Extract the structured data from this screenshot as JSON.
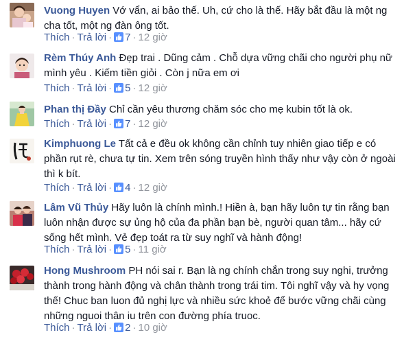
{
  "ui": {
    "like_label": "Thích",
    "reply_label": "Trả lời",
    "separator": "·"
  },
  "comments": [
    {
      "author": "Vuong Huyen",
      "text": "Vớ vẩn, ai bảo thế. Uh, cứ cho là thế. Hãy bắt đầu là một ng cha tốt, một ng đàn ông tốt.",
      "likes": "7",
      "time": "12 giờ",
      "avatar_icon": "woman-with-child-photo"
    },
    {
      "author": "Rèm Thúy Anh",
      "text": "Đẹp trai . Dũng cảm . Chỗ dựa vững chãi cho người phụ nữ mình yêu . Kiếm tiền giỏi . Còn j nữa em ơi",
      "likes": "5",
      "time": "12 giờ",
      "avatar_icon": "child-photo"
    },
    {
      "author": "Phan thị Đầy",
      "text": "Chỉ cần yêu thương chăm sóc cho mẹ kubin tốt là ok.",
      "likes": "7",
      "time": "12 giờ",
      "avatar_icon": "woman-in-yellow-dress-photo"
    },
    {
      "author": "Kimphuong Le",
      "text": "Tất cả e đều ok không cần chỉnh tuy nhiên giao tiếp e có phần rụt rè, chưa tự tin. Xem trên sóng truyền hình thấy như vậy còn ở ngoài thì k bít.",
      "likes": "4",
      "time": "12 giờ",
      "avatar_icon": "calligraphy-logo"
    },
    {
      "author": "Lâm Vũ Thủy",
      "text": "Hãy luôn là chính mình.! Hiền à, bạn hãy luôn tự tin rằng bạn luôn nhận được sự ủng hộ của đa phần bạn bè, người quan tâm... hãy cứ sống hết mình. Vẻ đẹp toát ra từ suy nghĩ và hành động!",
      "likes": "5",
      "time": "11 giờ",
      "avatar_icon": "two-people-photo"
    },
    {
      "author": "Hong Mushroom",
      "text": "PH nói sai r. Bạn là ng chính chắn trong suy nghi, trưởng thành trong hành động và chân thành trong trái tim. Tôi nghĩ vậy và hy vọng thế! Chuc ban luon đủ nghị lực và nhiều sức khoẻ để bước vững chãi cùng những nguoi thân iu trên con đường phía truoc.",
      "likes": "2",
      "time": "10 giờ",
      "avatar_icon": "red-roses-photo"
    }
  ]
}
